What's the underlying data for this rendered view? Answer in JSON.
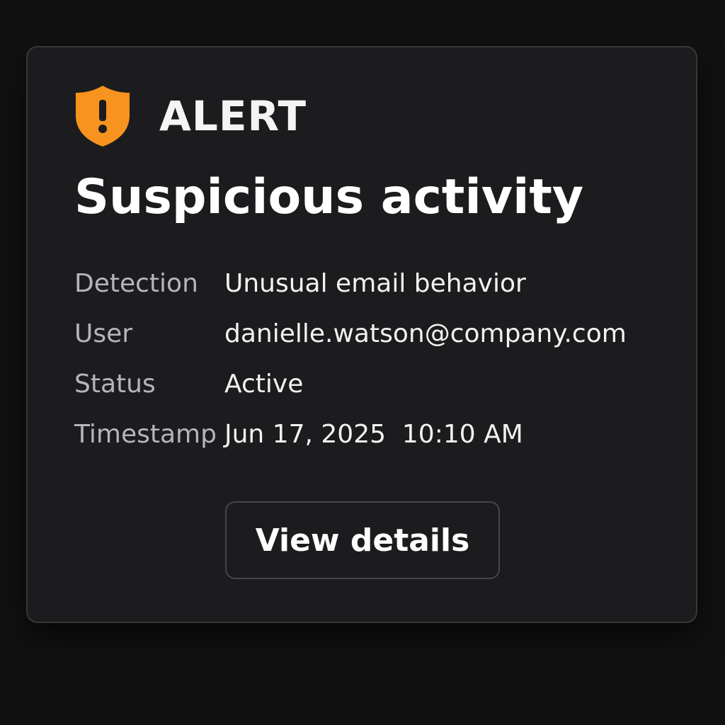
{
  "alert": {
    "label": "ALERT",
    "icon": "shield-warning-icon",
    "accent_color": "#F7931E"
  },
  "title": "Suspicious activity",
  "details": [
    {
      "label": "Detection",
      "value": "Unusual email behavior"
    },
    {
      "label": "User",
      "value": "danielle.watson@company.com"
    },
    {
      "label": "Status",
      "value": "Active"
    },
    {
      "label": "Timestamp",
      "value": "Jun 17, 2025  10:10 AM"
    }
  ],
  "actions": {
    "view_details_label": "View details"
  }
}
